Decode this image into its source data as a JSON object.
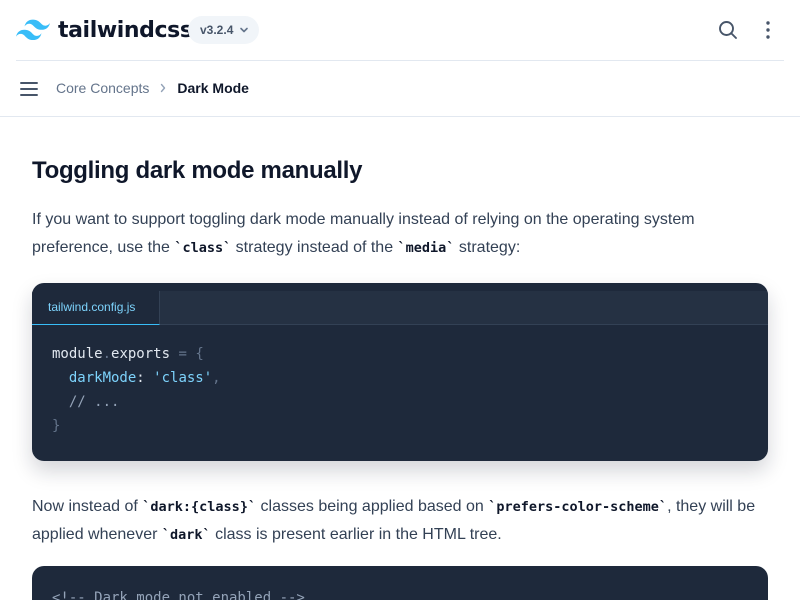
{
  "header": {
    "brand": "tailwindcss",
    "version": "v3.2.4",
    "brand_color": "#38bdf8"
  },
  "breadcrumb": {
    "parent": "Core Concepts",
    "current": "Dark Mode"
  },
  "article": {
    "heading": "Toggling dark mode manually",
    "para1": {
      "before": "If you want to support toggling dark mode manually instead of relying on the operating system preference, use the ",
      "code1": "`class`",
      "middle": " strategy instead of the ",
      "code2": "`media`",
      "after": " strategy:"
    },
    "code_block": {
      "filename": "tailwind.config.js",
      "lines": {
        "l1_a": "module",
        "l1_b": ".",
        "l1_c": "exports",
        "l1_d": " = {",
        "l2_key": "darkMode",
        "l2_colon": ": ",
        "l2_val": "'class'",
        "l2_comma": ",",
        "l3": "// ...",
        "l4": "}"
      }
    },
    "para2": {
      "before": "Now instead of ",
      "code1": "`dark:{class}`",
      "middle": " classes being applied based on ",
      "code2": "`prefers-color-scheme`",
      "after": ", they will be applied whenever ",
      "code3": "`dark`",
      "end": " class is present earlier in the HTML tree."
    },
    "code_block_2": {
      "first_line": "<!-- Dark mode not enabled -->"
    }
  },
  "icons": {
    "logo": "tailwind-logo-icon",
    "version": "chevron-down-icon",
    "search": "search-icon",
    "more": "more-vertical-icon",
    "menu": "menu-icon",
    "separator": "chevron-right-icon"
  }
}
